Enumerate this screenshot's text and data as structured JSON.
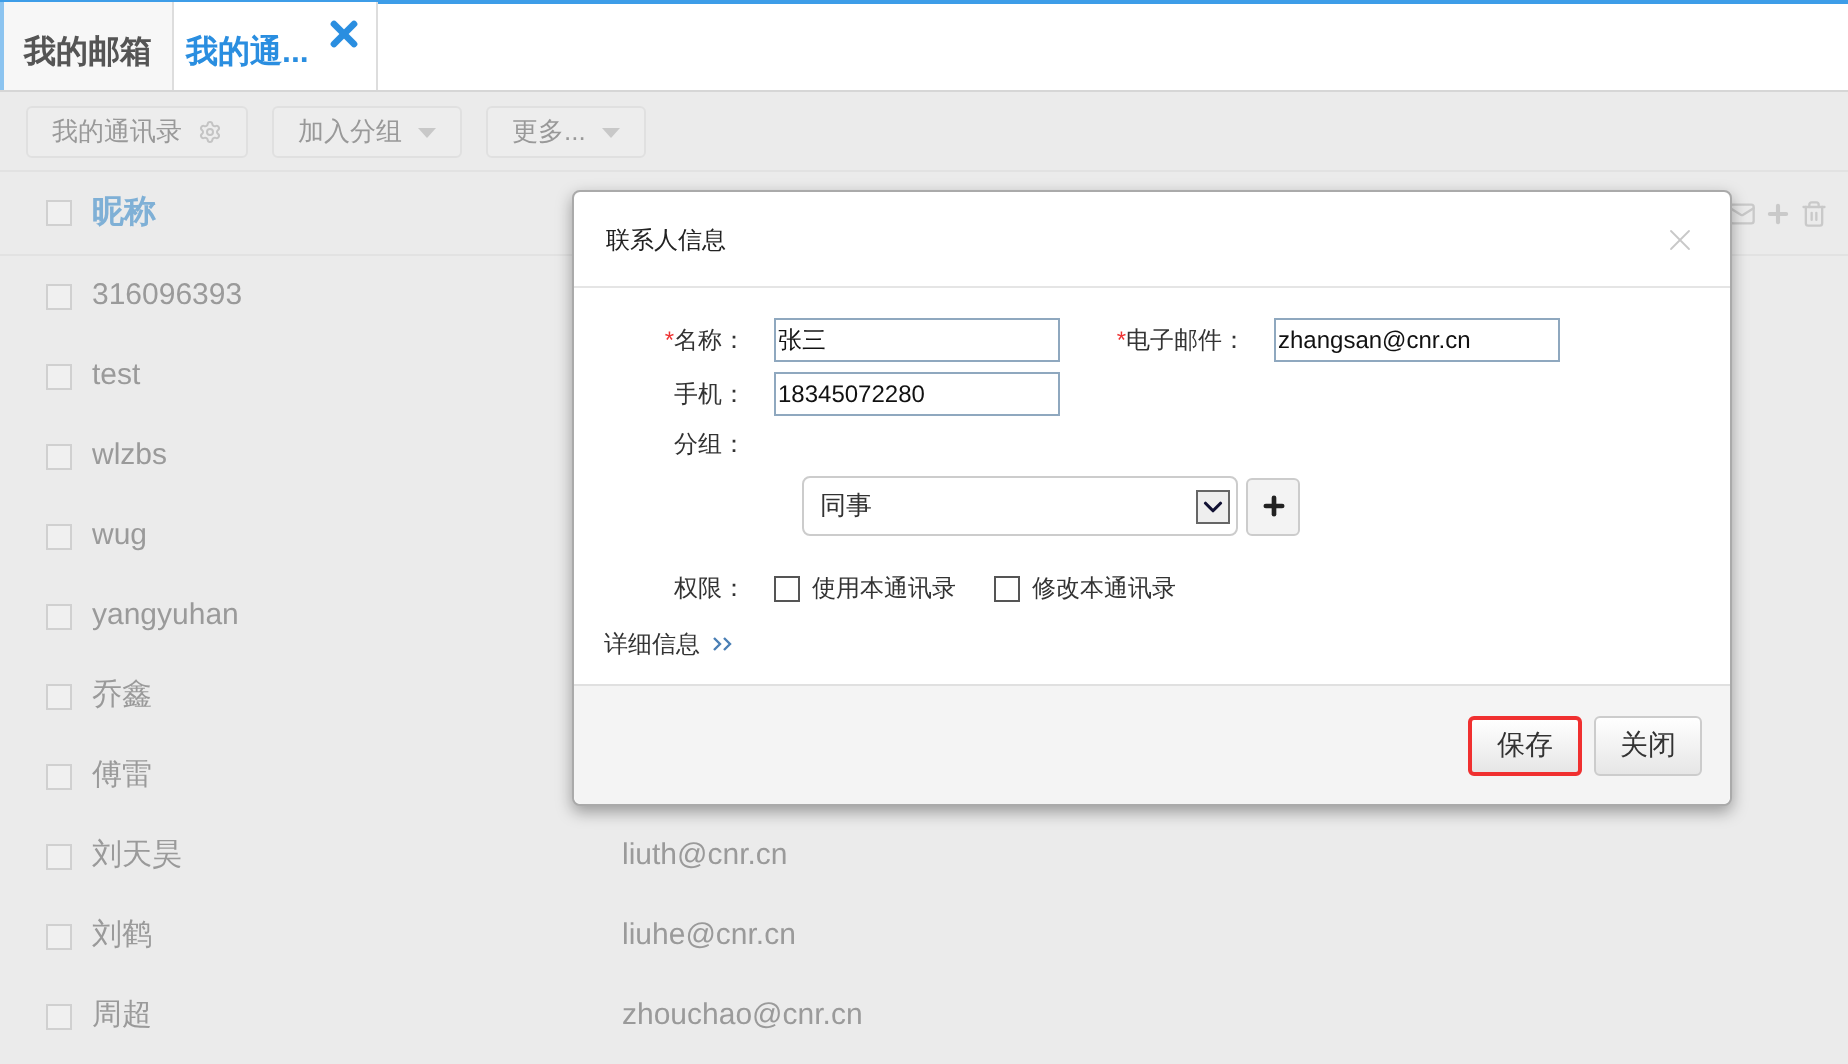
{
  "tabs": [
    {
      "label": "我的邮箱",
      "selected": false,
      "closable": false
    },
    {
      "label": "我的通...",
      "selected": true,
      "closable": true
    }
  ],
  "toolbar": [
    {
      "label": "我的通讯录",
      "kind": "gear"
    },
    {
      "label": "加入分组",
      "kind": "caret"
    },
    {
      "label": "更多...",
      "kind": "caret"
    }
  ],
  "list": {
    "header": {
      "label": "昵称",
      "checked": false
    },
    "rows": [
      {
        "name": "316096393",
        "checked": false
      },
      {
        "name": "test",
        "checked": false
      },
      {
        "name": "wlzbs",
        "checked": false
      },
      {
        "name": "wug",
        "checked": false
      },
      {
        "name": "yangyuhan",
        "checked": false
      },
      {
        "name": "乔鑫",
        "checked": false
      },
      {
        "name": "傅雷",
        "checked": false
      },
      {
        "name": "刘天昊",
        "checked": false,
        "email": "liuth@cnr.cn"
      },
      {
        "name": "刘鹤",
        "checked": false,
        "email": "liuhe@cnr.cn"
      },
      {
        "name": "周超",
        "checked": false,
        "email": "zhouchao@cnr.cn"
      }
    ]
  },
  "dialog": {
    "title": "联系人信息",
    "fields": [
      {
        "required_mark": "*",
        "label": "名称：",
        "value": "张三"
      },
      {
        "required_mark": "*",
        "label": "电子邮件：",
        "value": "zhangsan@cnr.cn"
      },
      {
        "label": "手机：",
        "value": "18345072280"
      }
    ],
    "group": {
      "label": "分组：",
      "value": "同事"
    },
    "permissions": {
      "label": "权限：",
      "options": [
        {
          "label": "使用本通讯录",
          "checked": false
        },
        {
          "label": "修改本通讯录",
          "checked": false
        }
      ]
    },
    "details_link": "详细信息",
    "buttons": [
      {
        "label": "保存",
        "highlighted": true
      },
      {
        "label": "关闭",
        "highlighted": false
      }
    ]
  }
}
